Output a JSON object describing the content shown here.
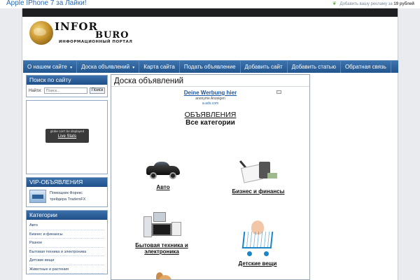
{
  "top_ad": {
    "promo_text": "Apple IPhone 7 за Лайки!",
    "ad_text": "Добавить вашу рекламу за",
    "ad_price": "19 рублей"
  },
  "header": {
    "logo_line1": "INFOR",
    "logo_line2": "BURO",
    "logo_subtitle": "ИНФОРМАЦИОННЫЙ ПОРТАЛ"
  },
  "nav": {
    "items": [
      {
        "label": "О нашем сайте",
        "caret": "▾"
      },
      {
        "label": "Доска объявлений",
        "caret": "▾"
      },
      {
        "label": "Карта сайта"
      },
      {
        "label": "Подать объявление"
      },
      {
        "label": "Добавить сайт"
      },
      {
        "label": "Добавить статью"
      },
      {
        "label": "Обратная связь"
      }
    ]
  },
  "sidebar": {
    "search": {
      "title": "Поиск по сайту",
      "label": "Найти:",
      "placeholder": "Поиск...",
      "button": "Поиск"
    },
    "globe": {
      "message": "globe can't be displayed",
      "link": "Live Stats"
    },
    "vip": {
      "title": "VIP-ОБЪЯВЛЕНИЯ",
      "item_line1": "Помощник Форекс",
      "item_line2": "трейдера TradersFX"
    },
    "categories": {
      "title": "Категории",
      "items": [
        "Авто",
        "Бизнес и финансы",
        "Разное",
        "Бытовая техника и электроника",
        "Детские вещи",
        "Животные и растения"
      ]
    }
  },
  "main": {
    "title": "Доска объявлений",
    "ad": {
      "link": "Deine Werbung hier",
      "sub": "anonyme Anzeigen",
      "url": "a-ads.com"
    },
    "heading": "ОБЪЯВЛЕНИЯ",
    "subheading": "Все категории",
    "tiles": [
      {
        "line1": "Авто",
        "line2": ""
      },
      {
        "line1": "Бизнес и финансы",
        "line2": ""
      },
      {
        "line1": "Бытовая техника и",
        "line2": "электроника"
      },
      {
        "line1": "Детские вещи",
        "line2": ""
      }
    ]
  },
  "colors": {
    "nav_blue": "#2c5f98",
    "link_blue": "#1b56a8",
    "page_bg": "#e9ebef"
  }
}
